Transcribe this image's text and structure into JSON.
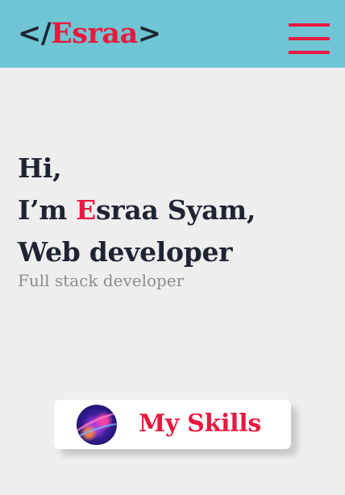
{
  "header": {
    "logo_open": "</",
    "logo_name": "Esraa",
    "logo_close": ">",
    "menu_icon": "hamburger-menu-icon"
  },
  "hero": {
    "line1": "Hi,",
    "line2_prefix": "I’m ",
    "line2_accent": "E",
    "line2_rest": "sraa Syam,",
    "line3": "Web developer",
    "subtitle": "Full stack developer"
  },
  "skills_button": {
    "label": "My Skills",
    "icon": "abstract-orb-icon"
  },
  "colors": {
    "header_bg": "#6fc5d3",
    "accent": "#e8193f",
    "text_dark": "#1f2433",
    "text_muted": "#8d8d8d",
    "page_bg": "#eeeeee"
  }
}
